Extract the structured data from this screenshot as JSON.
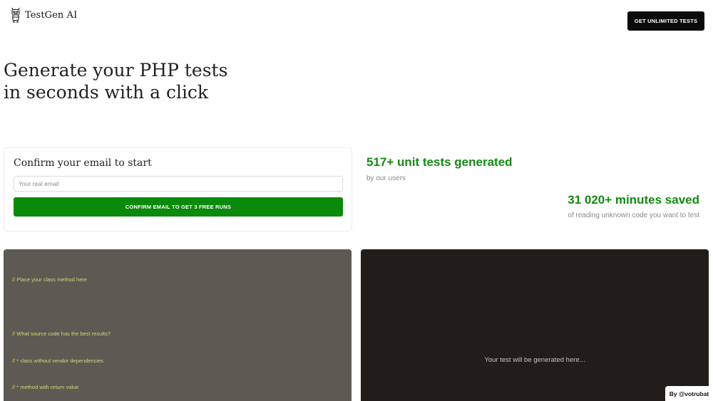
{
  "header": {
    "brand_name": "TestGen AI",
    "brand_logo_icon": "robot-icon",
    "cta_label": "GET UNLIMITED TESTS"
  },
  "hero": {
    "line1": "Generate your PHP tests",
    "line2": "in seconds with a click"
  },
  "confirm": {
    "title": "Confirm your email to start",
    "email_placeholder": "Your real email",
    "email_value": "",
    "button_label": "CONFIRM EMAIL TO GET 3 FREE RUNS"
  },
  "stats": {
    "tests_value": "517+ unit tests generated",
    "tests_label": "by our users",
    "minutes_value": "31 020+ minutes saved",
    "minutes_label": "of reading unknown code you want to test"
  },
  "editor": {
    "lines": [
      "// Place your class method here",
      "",
      "// What source code has the best results?",
      "// * class without vendor dependencies",
      "// * method with return value"
    ]
  },
  "output": {
    "placeholder": "Your test will be generated here..."
  },
  "footer": {
    "byline": "By @votrubat"
  },
  "colors": {
    "accent_green": "#0a8a0a",
    "stat_green": "#138a13",
    "editor_bg": "#5c5a53",
    "editor_text": "#d4d77a",
    "output_bg": "#231d1a",
    "header_button_bg": "#0b0b0b"
  }
}
